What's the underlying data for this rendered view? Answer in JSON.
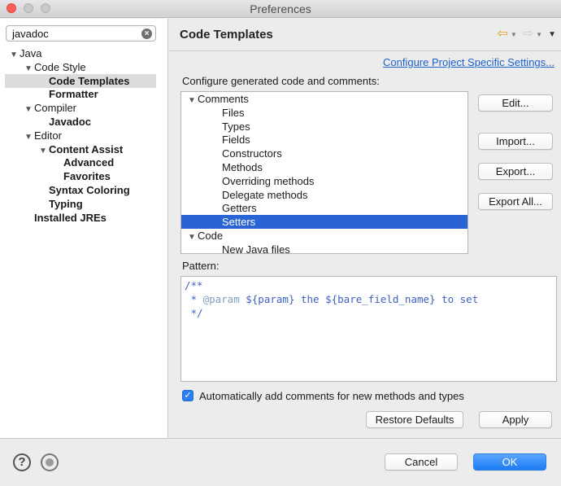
{
  "window": {
    "title": "Preferences"
  },
  "filter": {
    "value": "javadoc"
  },
  "tree": [
    {
      "label": "Java",
      "arrow": "▼",
      "bold": false,
      "indent": 0
    },
    {
      "label": "Code Style",
      "arrow": "▼",
      "bold": false,
      "indent": 1
    },
    {
      "label": "Code Templates",
      "arrow": "",
      "bold": true,
      "indent": 2,
      "selected": true
    },
    {
      "label": "Formatter",
      "arrow": "",
      "bold": true,
      "indent": 2
    },
    {
      "label": "Compiler",
      "arrow": "▼",
      "bold": false,
      "indent": 1
    },
    {
      "label": "Javadoc",
      "arrow": "",
      "bold": true,
      "indent": 2
    },
    {
      "label": "Editor",
      "arrow": "▼",
      "bold": false,
      "indent": 1
    },
    {
      "label": "Content Assist",
      "arrow": "▼",
      "bold": true,
      "indent": 2
    },
    {
      "label": "Advanced",
      "arrow": "",
      "bold": true,
      "indent": 3
    },
    {
      "label": "Favorites",
      "arrow": "",
      "bold": true,
      "indent": 3
    },
    {
      "label": "Syntax Coloring",
      "arrow": "",
      "bold": true,
      "indent": 2
    },
    {
      "label": "Typing",
      "arrow": "",
      "bold": true,
      "indent": 2
    },
    {
      "label": "Installed JREs",
      "arrow": "",
      "bold": true,
      "indent": 1
    }
  ],
  "page": {
    "title": "Code Templates",
    "configure_link": "Configure Project Specific Settings...",
    "configure_label": "Configure generated code and comments:",
    "pattern_label": "Pattern:"
  },
  "templates": [
    {
      "label": "Comments",
      "arrow": "▼",
      "indent": 0
    },
    {
      "label": "Files",
      "arrow": "",
      "indent": 1
    },
    {
      "label": "Types",
      "arrow": "",
      "indent": 1
    },
    {
      "label": "Fields",
      "arrow": "",
      "indent": 1
    },
    {
      "label": "Constructors",
      "arrow": "",
      "indent": 1
    },
    {
      "label": "Methods",
      "arrow": "",
      "indent": 1
    },
    {
      "label": "Overriding methods",
      "arrow": "",
      "indent": 1
    },
    {
      "label": "Delegate methods",
      "arrow": "",
      "indent": 1
    },
    {
      "label": "Getters",
      "arrow": "",
      "indent": 1
    },
    {
      "label": "Setters",
      "arrow": "",
      "indent": 1,
      "selected": true
    },
    {
      "label": "Code",
      "arrow": "▼",
      "indent": 0
    },
    {
      "label": "New Java files",
      "arrow": "",
      "indent": 1
    }
  ],
  "side_buttons": {
    "edit": "Edit...",
    "import": "Import...",
    "export": "Export...",
    "export_all": "Export All..."
  },
  "pattern": {
    "line1": "/**",
    "line2_prefix": " * ",
    "line2_tag": "@param",
    "line2_rest": " ${param} the ${bare_field_name} to set",
    "line3": " */"
  },
  "checkbox": {
    "label": "Automatically add comments for new methods and types",
    "checked": true
  },
  "buttons": {
    "restore_defaults": "Restore Defaults",
    "apply": "Apply",
    "cancel": "Cancel",
    "ok": "OK"
  },
  "icons": {
    "help": "?",
    "clear": "×",
    "back": "⇦",
    "forward": "⇨",
    "menu": "▼",
    "check": "✓"
  }
}
